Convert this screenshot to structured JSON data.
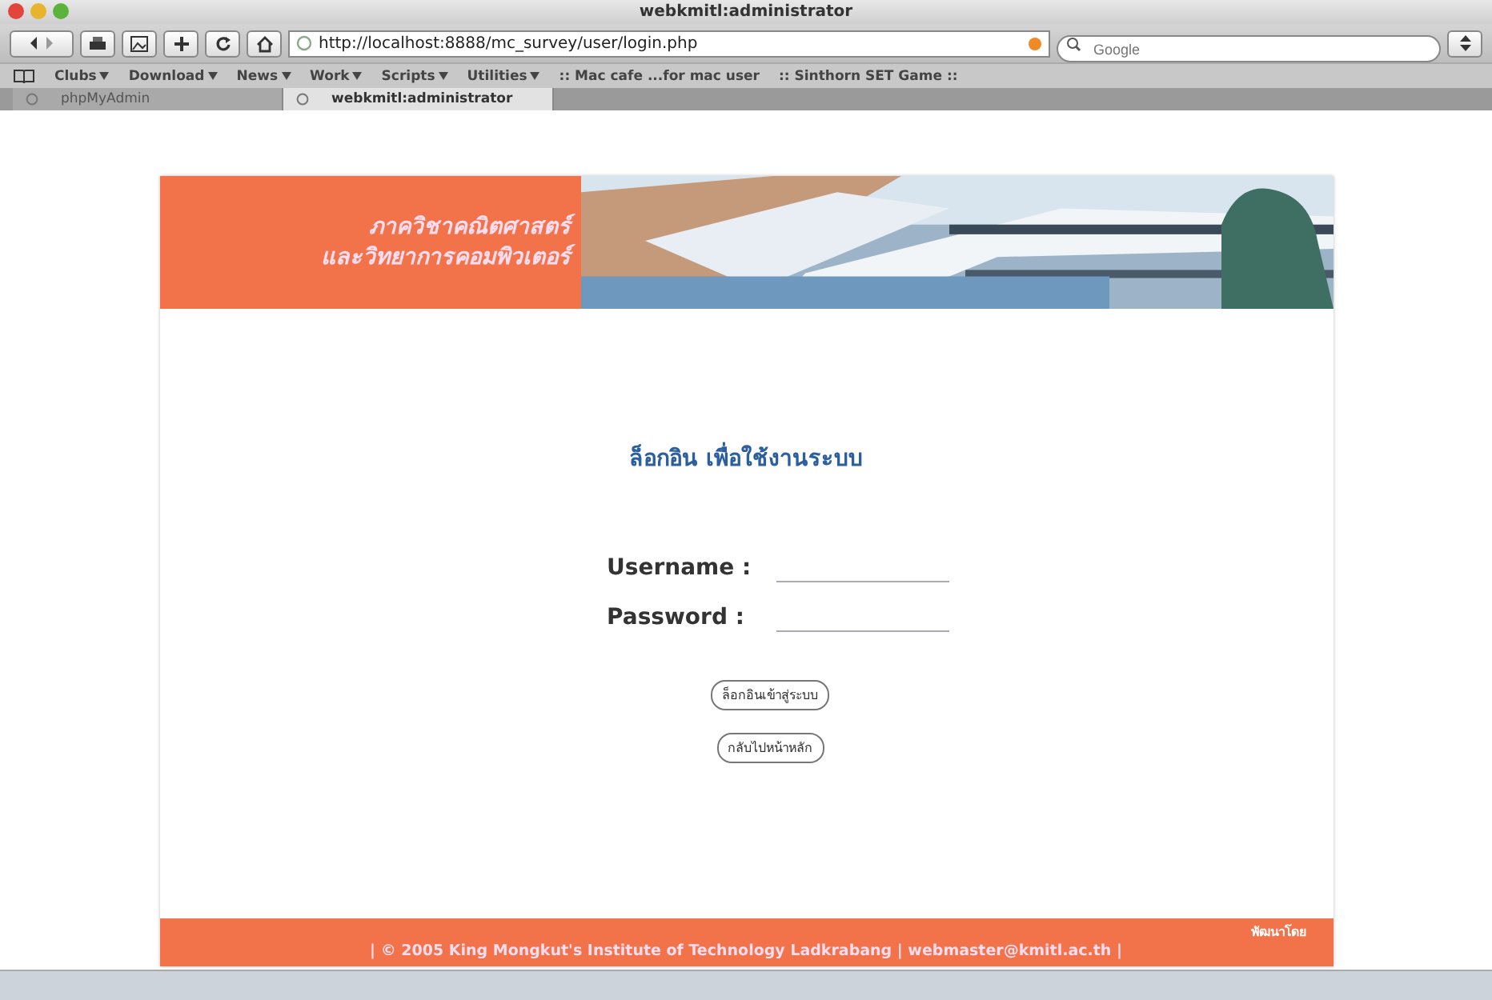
{
  "window": {
    "title": "webkmitl:administrator"
  },
  "toolbar": {
    "url": "http://localhost:8888/mc_survey/user/login.php",
    "search_placeholder": "Google"
  },
  "bookmarks": [
    {
      "label": "Clubs",
      "menu": true
    },
    {
      "label": "Download",
      "menu": true
    },
    {
      "label": "News",
      "menu": true
    },
    {
      "label": "Work",
      "menu": true
    },
    {
      "label": "Scripts",
      "menu": true
    },
    {
      "label": "Utilities",
      "menu": true
    },
    {
      "label": ":: Mac cafe ...for mac user",
      "menu": false
    },
    {
      "label": ":: Sinthorn SET Game ::",
      "menu": false
    }
  ],
  "tabs": [
    {
      "label": "phpMyAdmin",
      "selected": false
    },
    {
      "label": "webkmitl:administrator",
      "selected": true
    }
  ],
  "banner": {
    "lines": [
      "ภาควิชาคณิตศาสตร์",
      "และวิทยาการคอมพิวเตอร์"
    ],
    "kind": "picture"
  },
  "login": {
    "heading": "ล็อกอิน เพื่อใช้งานระบบ",
    "fields": [
      {
        "label": "Username :"
      },
      {
        "label": "Password :"
      }
    ],
    "buttons": [
      "ล็อกอินเข้าสู่ระบบ",
      "กลับไปหน้าหลัก"
    ]
  },
  "footer": {
    "credit": "พัฒนาโดย",
    "copyright": "| © 2005 King Mongkut's Institute of Technology Ladkrabang | webmaster@kmitl.ac.th |"
  }
}
